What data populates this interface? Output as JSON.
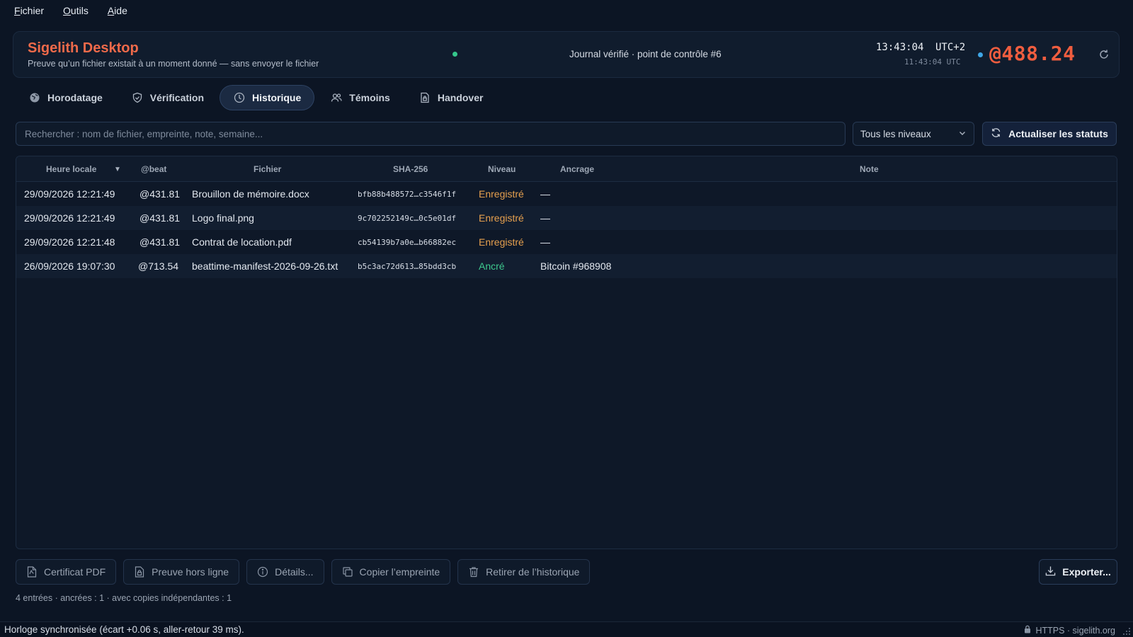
{
  "menu": [
    {
      "key": "F",
      "rest": "ichier"
    },
    {
      "key": "O",
      "rest": "utils"
    },
    {
      "key": "A",
      "rest": "ide"
    }
  ],
  "header": {
    "title": "Sigelith Desktop",
    "subtitle": "Preuve qu’un fichier existait à un moment donné — sans envoyer le fichier",
    "journal": "Journal vérifié · point de contrôle #6",
    "time_local": "13:43:04",
    "timezone": "UTC+2",
    "time_utc": "11:43:04 UTC",
    "beat": "@488.24",
    "status_color": "#35c68b",
    "beat_color": "#ef5d3f"
  },
  "tabs": [
    {
      "label": "Horodatage",
      "icon": "globe-icon",
      "active": false
    },
    {
      "label": "Vérification",
      "icon": "shield-check-icon",
      "active": false
    },
    {
      "label": "Historique",
      "icon": "clock-icon",
      "active": true
    },
    {
      "label": "Témoins",
      "icon": "users-icon",
      "active": false
    },
    {
      "label": "Handover",
      "icon": "document-lock-icon",
      "active": false
    }
  ],
  "search": {
    "placeholder": "Rechercher : nom de fichier, empreinte, note, semaine...",
    "value": ""
  },
  "filter": {
    "selected": "Tous les niveaux"
  },
  "refresh_button": "Actualiser les statuts",
  "table": {
    "columns": [
      "Heure locale",
      "@beat",
      "Fichier",
      "SHA-256",
      "Niveau",
      "Ancrage",
      "Note"
    ],
    "rows": [
      {
        "time": "29/09/2026 12:21:49",
        "beat": "@431.81",
        "file": "Brouillon de mémoire.docx",
        "hash": "bfb88b488572…c3546f1f",
        "level": "Enregistré",
        "level_color": "#e6a04e",
        "anchor": "—",
        "note": ""
      },
      {
        "time": "29/09/2026 12:21:49",
        "beat": "@431.81",
        "file": "Logo final.png",
        "hash": "9c702252149c…0c5e01df",
        "level": "Enregistré",
        "level_color": "#e6a04e",
        "anchor": "—",
        "note": ""
      },
      {
        "time": "29/09/2026 12:21:48",
        "beat": "@431.81",
        "file": "Contrat de location.pdf",
        "hash": "cb54139b7a0e…b66882ec",
        "level": "Enregistré",
        "level_color": "#e6a04e",
        "anchor": "—",
        "note": ""
      },
      {
        "time": "26/09/2026 19:07:30",
        "beat": "@713.54",
        "file": "beattime-manifest-2026-09-26.txt",
        "hash": "b5c3ac72d613…85bdd3cb",
        "level": "Ancré",
        "level_color": "#3ec98e",
        "anchor": "Bitcoin #968908",
        "note": ""
      }
    ]
  },
  "actions": [
    {
      "label": "Certificat PDF",
      "icon": "pdf-file-icon"
    },
    {
      "label": "Preuve hors ligne",
      "icon": "offline-file-icon"
    },
    {
      "label": "Détails...",
      "icon": "info-icon"
    },
    {
      "label": "Copier l’empreinte",
      "icon": "copy-icon"
    },
    {
      "label": "Retirer de l’historique",
      "icon": "trash-icon"
    }
  ],
  "export_button": "Exporter...",
  "summary": "4 entrées · ancrées : 1 · avec copies indépendantes : 1",
  "statusbar": {
    "left": "Horloge synchronisée (écart +0.06 s, aller-retour 39 ms).",
    "right": "HTTPS · sigelith.org"
  }
}
